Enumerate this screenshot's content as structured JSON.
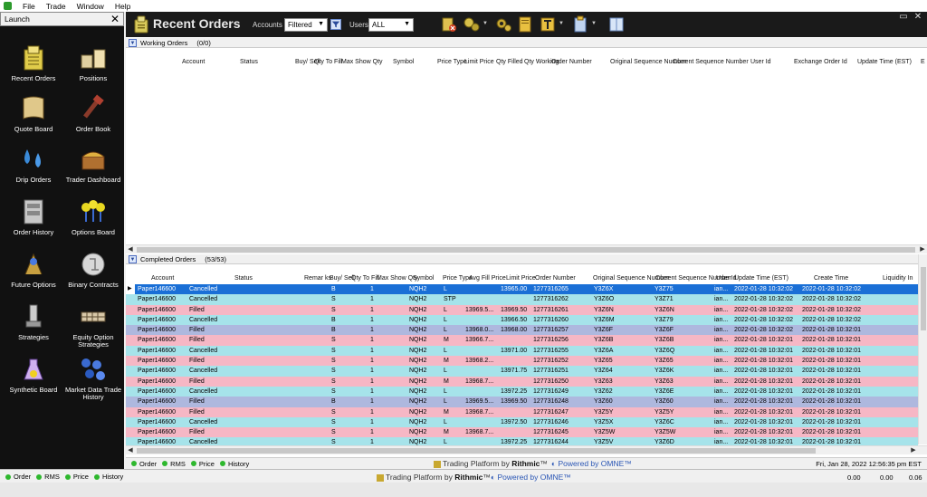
{
  "menubar": {
    "items": [
      "File",
      "Trade",
      "Window",
      "Help"
    ]
  },
  "launch": {
    "title": "Launch",
    "close": "✕",
    "items": [
      {
        "label": "Recent Orders",
        "icon": "recent-orders-icon"
      },
      {
        "label": "Positions",
        "icon": "positions-icon"
      },
      {
        "label": "Quote Board",
        "icon": "quote-board-icon"
      },
      {
        "label": "Order Book",
        "icon": "order-book-icon"
      },
      {
        "label": "Drip Orders",
        "icon": "drip-orders-icon"
      },
      {
        "label": "Trader Dashboard",
        "icon": "trader-dashboard-icon"
      },
      {
        "label": "Order History",
        "icon": "order-history-icon"
      },
      {
        "label": "Options Board",
        "icon": "options-board-icon"
      },
      {
        "label": "Future Options",
        "icon": "future-options-icon"
      },
      {
        "label": "Binary Contracts",
        "icon": "binary-contracts-icon"
      },
      {
        "label": "Strategies",
        "icon": "strategies-icon"
      },
      {
        "label": "Equity Option Strategies",
        "icon": "equity-option-strategies-icon"
      },
      {
        "label": "Synthetic Board",
        "icon": "synthetic-board-icon"
      },
      {
        "label": "Market Data Trade History",
        "icon": "market-data-trade-history-icon"
      }
    ]
  },
  "toolbar": {
    "title": "Recent Orders",
    "accounts_label": "Accounts",
    "accounts_value": "Filtered",
    "users_label": "Users",
    "users_value": "ALL",
    "win_buttons": [
      "▭",
      "✕"
    ]
  },
  "working": {
    "title": "Working Orders",
    "count": "(0/0)",
    "headers": [
      "Account",
      "Status",
      "Buy/ Sell",
      "Qty To Fill",
      "Max Show Qty",
      "Symbol",
      "Price Type",
      "Limit Price",
      "Qty Filled",
      "Qty Working",
      "Order Number",
      "Original Sequence Number",
      "Current Sequence Number",
      "User Id",
      "Exchange Order Id",
      "Update Time (EST)",
      "E"
    ]
  },
  "completed": {
    "title": "Completed Orders",
    "count": "(53/53)",
    "headers": [
      "Account",
      "Status",
      "Remar ks",
      "Buy/ Sell",
      "Qty To Fill",
      "Max Show Qty",
      "Symbol",
      "Price Type",
      "Avg Fill Price",
      "Limit Price",
      "Order Number",
      "Original Sequence Number",
      "Current Sequence Number",
      "User Id",
      "Update Time (EST)",
      "Create Time",
      "Liquidity In"
    ],
    "rows": [
      {
        "account": "Paper146600",
        "status": "Cancelled",
        "side": "B",
        "qty": "1",
        "symbol": "NQH2",
        "ptype": "L",
        "avg": "",
        "limit": "13965.00",
        "order": "1277316265",
        "orig": "Y3Z6X",
        "cur": "Y3Z75",
        "user": "ian...",
        "update": "2022-01-28 10:32:02",
        "create": "2022-01-28 10:32:02",
        "bg": "#1a6fd6",
        "fg": "#ffffff"
      },
      {
        "account": "Paper146600",
        "status": "Cancelled",
        "side": "S",
        "qty": "1",
        "symbol": "NQH2",
        "ptype": "STP",
        "avg": "",
        "limit": "",
        "order": "1277316262",
        "orig": "Y3Z6O",
        "cur": "Y3Z71",
        "user": "ian...",
        "update": "2022-01-28 10:32:02",
        "create": "2022-01-28 10:32:02",
        "bg": "#a6e3ea",
        "fg": "#000000"
      },
      {
        "account": "Paper146600",
        "status": "Filled",
        "side": "S",
        "qty": "1",
        "symbol": "NQH2",
        "ptype": "L",
        "avg": "13969.5...",
        "limit": "13969.50",
        "order": "1277316261",
        "orig": "Y3Z6N",
        "cur": "Y3Z6N",
        "user": "ian...",
        "update": "2022-01-28 10:32:02",
        "create": "2022-01-28 10:32:02",
        "bg": "#f6b7c5",
        "fg": "#000000"
      },
      {
        "account": "Paper146600",
        "status": "Cancelled",
        "side": "B",
        "qty": "1",
        "symbol": "NQH2",
        "ptype": "L",
        "avg": "",
        "limit": "13966.50",
        "order": "1277316260",
        "orig": "Y3Z6M",
        "cur": "Y3Z79",
        "user": "ian...",
        "update": "2022-01-28 10:32:02",
        "create": "2022-01-28 10:32:02",
        "bg": "#a6e3ea",
        "fg": "#000000"
      },
      {
        "account": "Paper146600",
        "status": "Filled",
        "side": "B",
        "qty": "1",
        "symbol": "NQH2",
        "ptype": "L",
        "avg": "13968.0...",
        "limit": "13968.00",
        "order": "1277316257",
        "orig": "Y3Z6F",
        "cur": "Y3Z6F",
        "user": "ian...",
        "update": "2022-01-28 10:32:02",
        "create": "2022-01-28 10:32:01",
        "bg": "#aeb8de",
        "fg": "#000000"
      },
      {
        "account": "Paper146600",
        "status": "Filled",
        "side": "S",
        "qty": "1",
        "symbol": "NQH2",
        "ptype": "M",
        "avg": "13966.7...",
        "limit": "",
        "order": "1277316256",
        "orig": "Y3Z6B",
        "cur": "Y3Z6B",
        "user": "ian...",
        "update": "2022-01-28 10:32:01",
        "create": "2022-01-28 10:32:01",
        "bg": "#f6b7c5",
        "fg": "#000000"
      },
      {
        "account": "Paper146600",
        "status": "Cancelled",
        "side": "S",
        "qty": "1",
        "symbol": "NQH2",
        "ptype": "L",
        "avg": "",
        "limit": "13971.00",
        "order": "1277316255",
        "orig": "Y3Z6A",
        "cur": "Y3Z6Q",
        "user": "ian...",
        "update": "2022-01-28 10:32:01",
        "create": "2022-01-28 10:32:01",
        "bg": "#a6e3ea",
        "fg": "#000000"
      },
      {
        "account": "Paper146600",
        "status": "Filled",
        "side": "S",
        "qty": "1",
        "symbol": "NQH2",
        "ptype": "M",
        "avg": "13968.2...",
        "limit": "",
        "order": "1277316252",
        "orig": "Y3Z65",
        "cur": "Y3Z65",
        "user": "ian...",
        "update": "2022-01-28 10:32:01",
        "create": "2022-01-28 10:32:01",
        "bg": "#f6b7c5",
        "fg": "#000000"
      },
      {
        "account": "Paper146600",
        "status": "Cancelled",
        "side": "S",
        "qty": "1",
        "symbol": "NQH2",
        "ptype": "L",
        "avg": "",
        "limit": "13971.75",
        "order": "1277316251",
        "orig": "Y3Z64",
        "cur": "Y3Z6K",
        "user": "ian...",
        "update": "2022-01-28 10:32:01",
        "create": "2022-01-28 10:32:01",
        "bg": "#a6e3ea",
        "fg": "#000000"
      },
      {
        "account": "Paper146600",
        "status": "Filled",
        "side": "S",
        "qty": "1",
        "symbol": "NQH2",
        "ptype": "M",
        "avg": "13968.7...",
        "limit": "",
        "order": "1277316250",
        "orig": "Y3Z63",
        "cur": "Y3Z63",
        "user": "ian...",
        "update": "2022-01-28 10:32:01",
        "create": "2022-01-28 10:32:01",
        "bg": "#f6b7c5",
        "fg": "#000000"
      },
      {
        "account": "Paper146600",
        "status": "Cancelled",
        "side": "S",
        "qty": "1",
        "symbol": "NQH2",
        "ptype": "L",
        "avg": "",
        "limit": "13972.25",
        "order": "1277316249",
        "orig": "Y3Z62",
        "cur": "Y3Z6E",
        "user": "ian...",
        "update": "2022-01-28 10:32:01",
        "create": "2022-01-28 10:32:01",
        "bg": "#a6e3ea",
        "fg": "#000000"
      },
      {
        "account": "Paper146600",
        "status": "Filled",
        "side": "B",
        "qty": "1",
        "symbol": "NQH2",
        "ptype": "L",
        "avg": "13969.5...",
        "limit": "13969.50",
        "order": "1277316248",
        "orig": "Y3Z60",
        "cur": "Y3Z60",
        "user": "ian...",
        "update": "2022-01-28 10:32:01",
        "create": "2022-01-28 10:32:01",
        "bg": "#aeb8de",
        "fg": "#000000"
      },
      {
        "account": "Paper146600",
        "status": "Filled",
        "side": "S",
        "qty": "1",
        "symbol": "NQH2",
        "ptype": "M",
        "avg": "13968.7...",
        "limit": "",
        "order": "1277316247",
        "orig": "Y3Z5Y",
        "cur": "Y3Z5Y",
        "user": "ian...",
        "update": "2022-01-28 10:32:01",
        "create": "2022-01-28 10:32:01",
        "bg": "#f6b7c5",
        "fg": "#000000"
      },
      {
        "account": "Paper146600",
        "status": "Cancelled",
        "side": "S",
        "qty": "1",
        "symbol": "NQH2",
        "ptype": "L",
        "avg": "",
        "limit": "13972.50",
        "order": "1277316246",
        "orig": "Y3Z5X",
        "cur": "Y3Z6C",
        "user": "ian...",
        "update": "2022-01-28 10:32:01",
        "create": "2022-01-28 10:32:01",
        "bg": "#a6e3ea",
        "fg": "#000000"
      },
      {
        "account": "Paper146600",
        "status": "Filled",
        "side": "S",
        "qty": "1",
        "symbol": "NQH2",
        "ptype": "M",
        "avg": "13968.7...",
        "limit": "",
        "order": "1277316245",
        "orig": "Y3Z5W",
        "cur": "Y3Z5W",
        "user": "ian...",
        "update": "2022-01-28 10:32:01",
        "create": "2022-01-28 10:32:01",
        "bg": "#f6b7c5",
        "fg": "#000000"
      },
      {
        "account": "Paper146600",
        "status": "Cancelled",
        "side": "S",
        "qty": "1",
        "symbol": "NQH2",
        "ptype": "L",
        "avg": "",
        "limit": "13972.25",
        "order": "1277316244",
        "orig": "Y3Z5V",
        "cur": "Y3Z6D",
        "user": "ian...",
        "update": "2022-01-28 10:32:01",
        "create": "2022-01-28 10:32:01",
        "bg": "#a6e3ea",
        "fg": "#000000"
      }
    ]
  },
  "inner_status": {
    "items": [
      "Order",
      "RMS",
      "Price",
      "History"
    ],
    "brand_prefix": "Trading Platform by",
    "brand_name": "Rithmic",
    "tm": "™",
    "powered": "Powered by OMNE™",
    "datetime": "Fri, Jan 28, 2022 12:56:35 pm EST"
  },
  "statusbar": {
    "items": [
      "Order",
      "RMS",
      "Price",
      "History"
    ],
    "values": [
      "0.00",
      "0.00",
      "0.06"
    ]
  },
  "footer": {
    "brand_prefix": "Trading Platform by",
    "brand_name": "Rithmic",
    "tm": "™",
    "powered": "Powered by OMNE™"
  },
  "colors": {
    "dark_panel": "#111111",
    "selected_row": "#1a6fd6",
    "cancelled_row": "#a6e3ea",
    "filled_sell_row": "#f6b7c5",
    "filled_buy_row": "#aeb8de",
    "status_ok": "#2eb82e"
  }
}
